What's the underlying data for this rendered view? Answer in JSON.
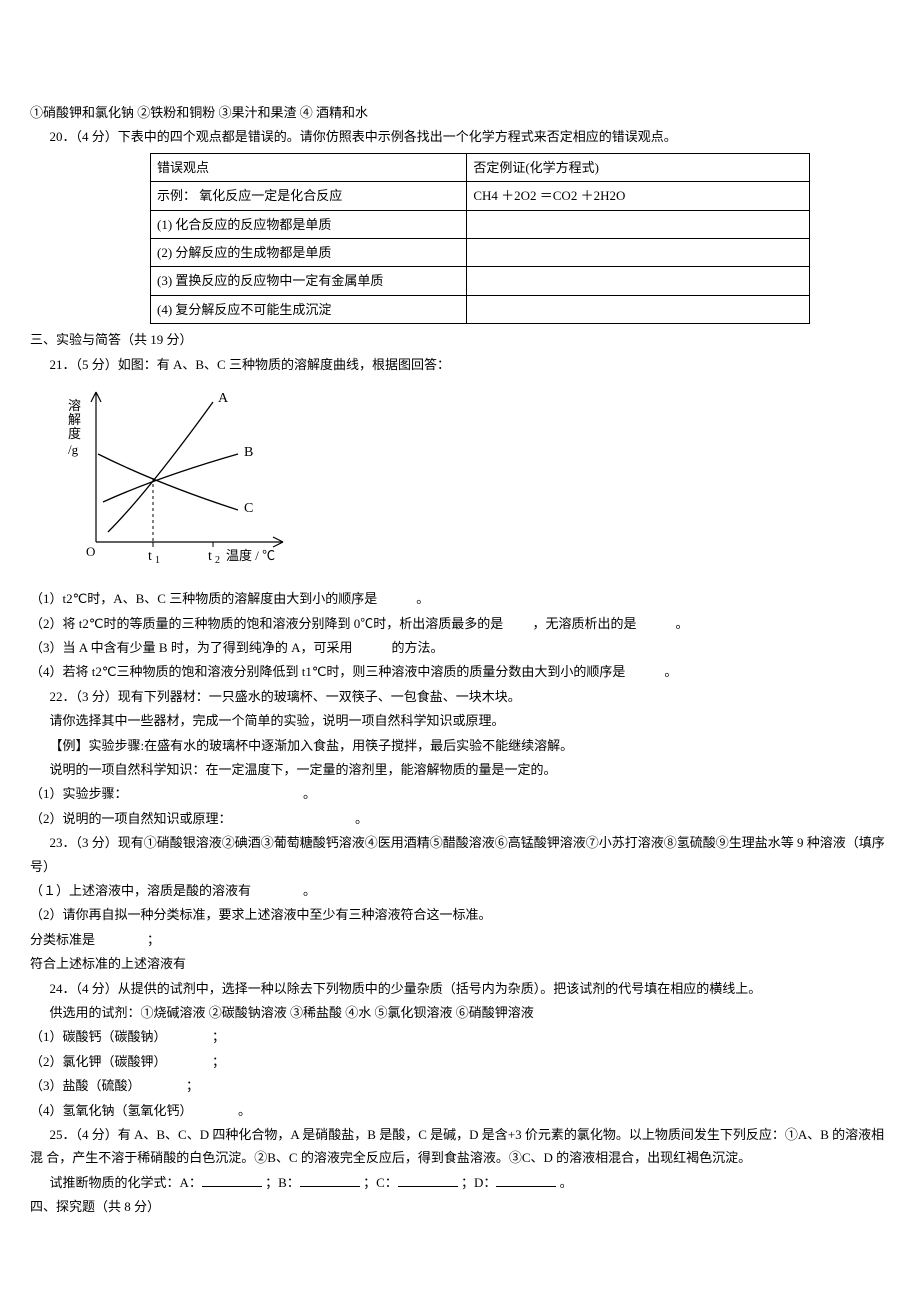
{
  "p19_continued": "①硝酸钾和氯化钠  ②铁粉和铜粉  ③果汁和果渣  ④ 酒精和水",
  "q20": {
    "stem": "20．（4 分）下表中的四个观点都是错误的。请你仿照表中示例各找出一个化学方程式来否定相应的错误观点。",
    "header": {
      "c1": "错误观点",
      "c2": "否定例证(化学方程式)"
    },
    "example": {
      "c1": "示例：  氧化反应一定是化合反应",
      "c2": "CH4 ＋2O2 ＝CO2 ＋2H2O"
    },
    "rows": [
      "(1) 化合反应的反应物都是单质",
      "(2) 分解反应的生成物都是单质",
      "(3) 置换反应的反应物中一定有金属单质",
      "(4) 复分解反应不可能生成沉淀"
    ]
  },
  "section3": "三、实验与简答（共 19 分）",
  "q21": {
    "stem": "21．（5 分）如图：有 A、B、C 三种物质的溶解度曲线，根据图回答：",
    "sub1": "（1）t2℃时，A、B、C 三种物质的溶解度由大到小的顺序是　　　。",
    "sub2": "（2）将 t2℃时的等质量的三种物质的饱和溶液分别降到 0℃时，析出溶质最多的是　　 ，无溶质析出的是　　　。",
    "sub3": "（3）当 A 中含有少量 B 时，为了得到纯净的 A，可采用　　　的方法。",
    "sub4": "（4）若将 t2℃三种物质的饱和溶液分别降低到 t1℃时，则三种溶液中溶质的质量分数由大到小的顺序是　　　。"
  },
  "q22": {
    "stem": "22．（3 分）现有下列器材：一只盛水的玻璃杯、一双筷子、一包食盐、一块木块。",
    "l2": "请你选择其中一些器材，完成一个简单的实验，说明一项自然科学知识或原理。",
    "l3": "【例】实验步骤:在盛有水的玻璃杯中逐渐加入食盐，用筷子搅拌，最后实验不能继续溶解。",
    "l4": "说明的一项自然科学知识：在一定温度下，一定量的溶剂里，能溶解物质的量是一定的。",
    "sub1": "（1）实验步骤：　　　　　　　　　　　　　　。",
    "sub2": "（2）说明的一项自然知识或原理：　　　　　　　　　　。"
  },
  "q23": {
    "stem": "23．（3 分）现有①硝酸银溶液②碘酒③葡萄糖酸钙溶液④医用酒精⑤醋酸溶液⑥高锰酸钾溶液⑦小苏打溶液⑧氢硫酸⑨生理盐水等 9 种溶液（填序号）",
    "sub1": "（１）上述溶液中，溶质是酸的溶液有　　　　。",
    "sub2": "（2）请你再自拟一种分类标准，要求上述溶液中至少有三种溶液符合这一标准。",
    "l3": "分类标准是　　　　；",
    "l4": "符合上述标准的上述溶液有"
  },
  "q24": {
    "stem": "24．（4 分）从提供的试剂中，选择一种以除去下列物质中的少量杂质（括号内为杂质）。把该试剂的代号填在相应的横线上。",
    "l2": "供选用的试剂：①烧碱溶液  ②碳酸钠溶液  ③稀盐酸  ④水  ⑤氯化钡溶液  ⑥硝酸钾溶液",
    "sub1": "（1）碳酸钙（碳酸钠）　　　　；",
    "sub2": "（2）氯化钾（碳酸钾）　　　　；",
    "sub3": "（3）盐酸（硫酸）　　　　；",
    "sub4": "（4）氢氧化钠（氢氧化钙）　　　　。"
  },
  "q25": {
    "stem": "25．（4 分）有 A、B、C、D 四种化合物，A 是硝酸盐，B 是酸，C 是碱，D 是含+3 价元素的氯化物。以上物质间发生下列反应：①A、B 的溶液相混  合，产生不溶于稀硝酸的白色沉淀。②B、C 的溶液完全反应后，得到食盐溶液。③C、D 的溶液相混合，出现红褐色沉淀。",
    "l2_prefix": "试推断物质的化学式：A：",
    "l2_b": "；B：",
    "l2_c": "；C：",
    "l2_d": "；D：",
    "l2_end": "。"
  },
  "section4": "四、探究题（共 8 分）",
  "chart_data": {
    "type": "line",
    "title": "",
    "xlabel": "温度 / ℃",
    "ylabel": "溶解度/g",
    "x_ticks": [
      "O",
      "t1",
      "t2"
    ],
    "series": [
      {
        "name": "A",
        "description": "steep increasing line, highest at t2"
      },
      {
        "name": "B",
        "description": "gentle increasing line, intersects A near t1"
      },
      {
        "name": "C",
        "description": "decreasing line, starts high at 0, intersects A and B near t1"
      }
    ],
    "intersection": "All three curves intersect near t1"
  }
}
